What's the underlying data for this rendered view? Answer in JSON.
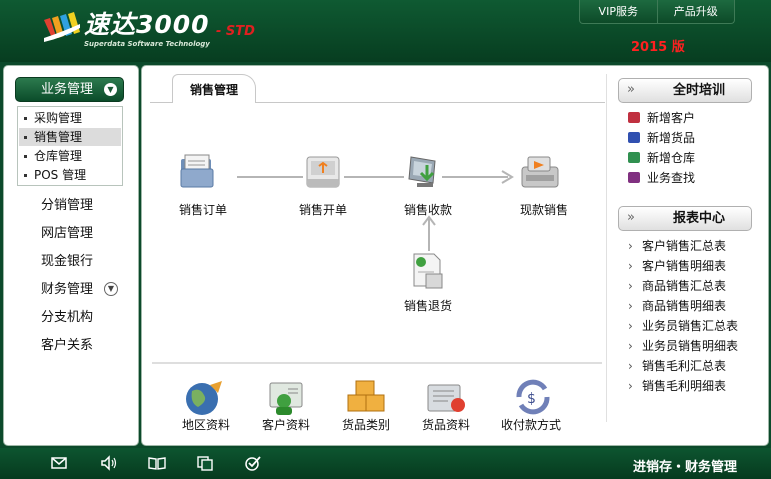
{
  "header": {
    "brand": "速达3000",
    "brand_sub": "Superdata Software Technology",
    "edition": "- STD",
    "vip_label": "VIP服务",
    "upgrade_label": "产品升级",
    "year": "2015 版"
  },
  "sidebar": {
    "business_header": "业务管理",
    "sub_items": [
      "采购管理",
      "销售管理",
      "仓库管理",
      "POS 管理"
    ],
    "selected_sub": "销售管理",
    "items": [
      "分销管理",
      "网店管理",
      "现金银行",
      "财务管理",
      "分支机构",
      "客户关系"
    ]
  },
  "main": {
    "tab": "销售管理",
    "flow": [
      "销售订单",
      "销售开单",
      "销售收款",
      "现款销售",
      "销售退货"
    ],
    "bottom": [
      "地区资料",
      "客户资料",
      "货品类别",
      "货品资料",
      "收付款方式"
    ]
  },
  "right": {
    "training_title": "全时培训",
    "training_items": [
      "新增客户",
      "新增货品",
      "新增仓库",
      "业务查找"
    ],
    "report_title": "报表中心",
    "reports": [
      "客户销售汇总表",
      "客户销售明细表",
      "商品销售汇总表",
      "商品销售明细表",
      "业务员销售汇总表",
      "业务员销售明细表",
      "销售毛利汇总表",
      "销售毛利明细表"
    ]
  },
  "footer": {
    "text": "进销存・财务管理",
    "icons": [
      "mail-icon",
      "speaker-icon",
      "book-icon",
      "copy-icon",
      "check-icon"
    ]
  },
  "colors": {
    "header_green": "#0f5a32",
    "year_red": "#ff2020",
    "edition_red": "#e02020"
  }
}
